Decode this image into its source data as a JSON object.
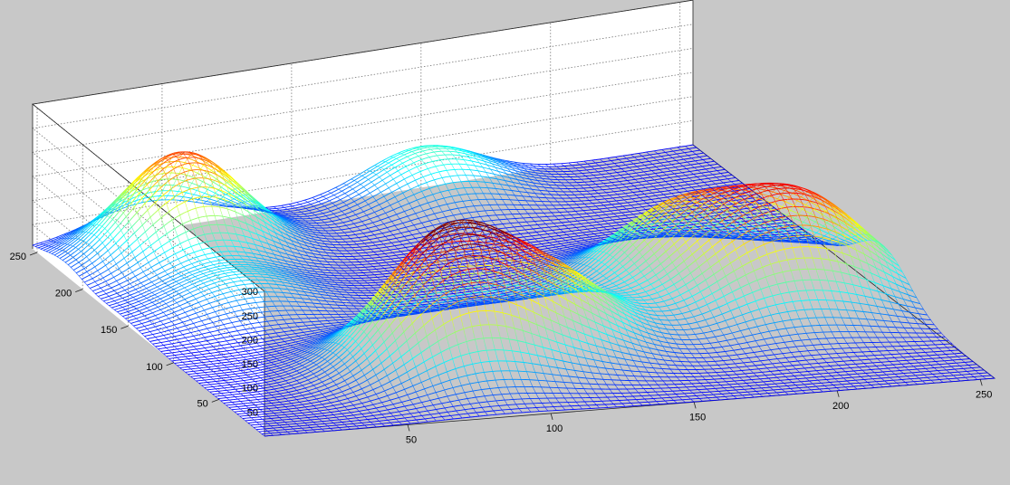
{
  "chart_data": {
    "type": "surface",
    "title": "",
    "xlabel": "",
    "ylabel": "",
    "zlabel": "",
    "xlim": [
      0,
      255
    ],
    "ylim": [
      0,
      255
    ],
    "zlim": [
      0,
      300
    ],
    "grid": true,
    "colormap": "jet",
    "x_ticks": [
      "50",
      "100",
      "150",
      "200",
      "250"
    ],
    "y_ticks": [
      "50",
      "100",
      "150",
      "200",
      "250"
    ],
    "z_ticks": [
      "50",
      "100",
      "150",
      "200",
      "250",
      "300"
    ],
    "peaks": [
      {
        "x": 45,
        "y": 220,
        "height": 215
      },
      {
        "x": 150,
        "y": 245,
        "height": 95
      },
      {
        "x": 42,
        "y": 155,
        "height": 65
      },
      {
        "x": 85,
        "y": 60,
        "height": 270
      },
      {
        "x": 125,
        "y": 70,
        "height": 150
      },
      {
        "x": 190,
        "y": 120,
        "height": 155
      },
      {
        "x": 200,
        "y": 80,
        "height": 95
      },
      {
        "x": 230,
        "y": 95,
        "height": 175
      }
    ]
  },
  "colors": {
    "background": "#c8c8c8",
    "box_panel": "#ffffff",
    "grid_line": "#777777",
    "surface_low": "#00008f",
    "surface_high": "#800000"
  }
}
